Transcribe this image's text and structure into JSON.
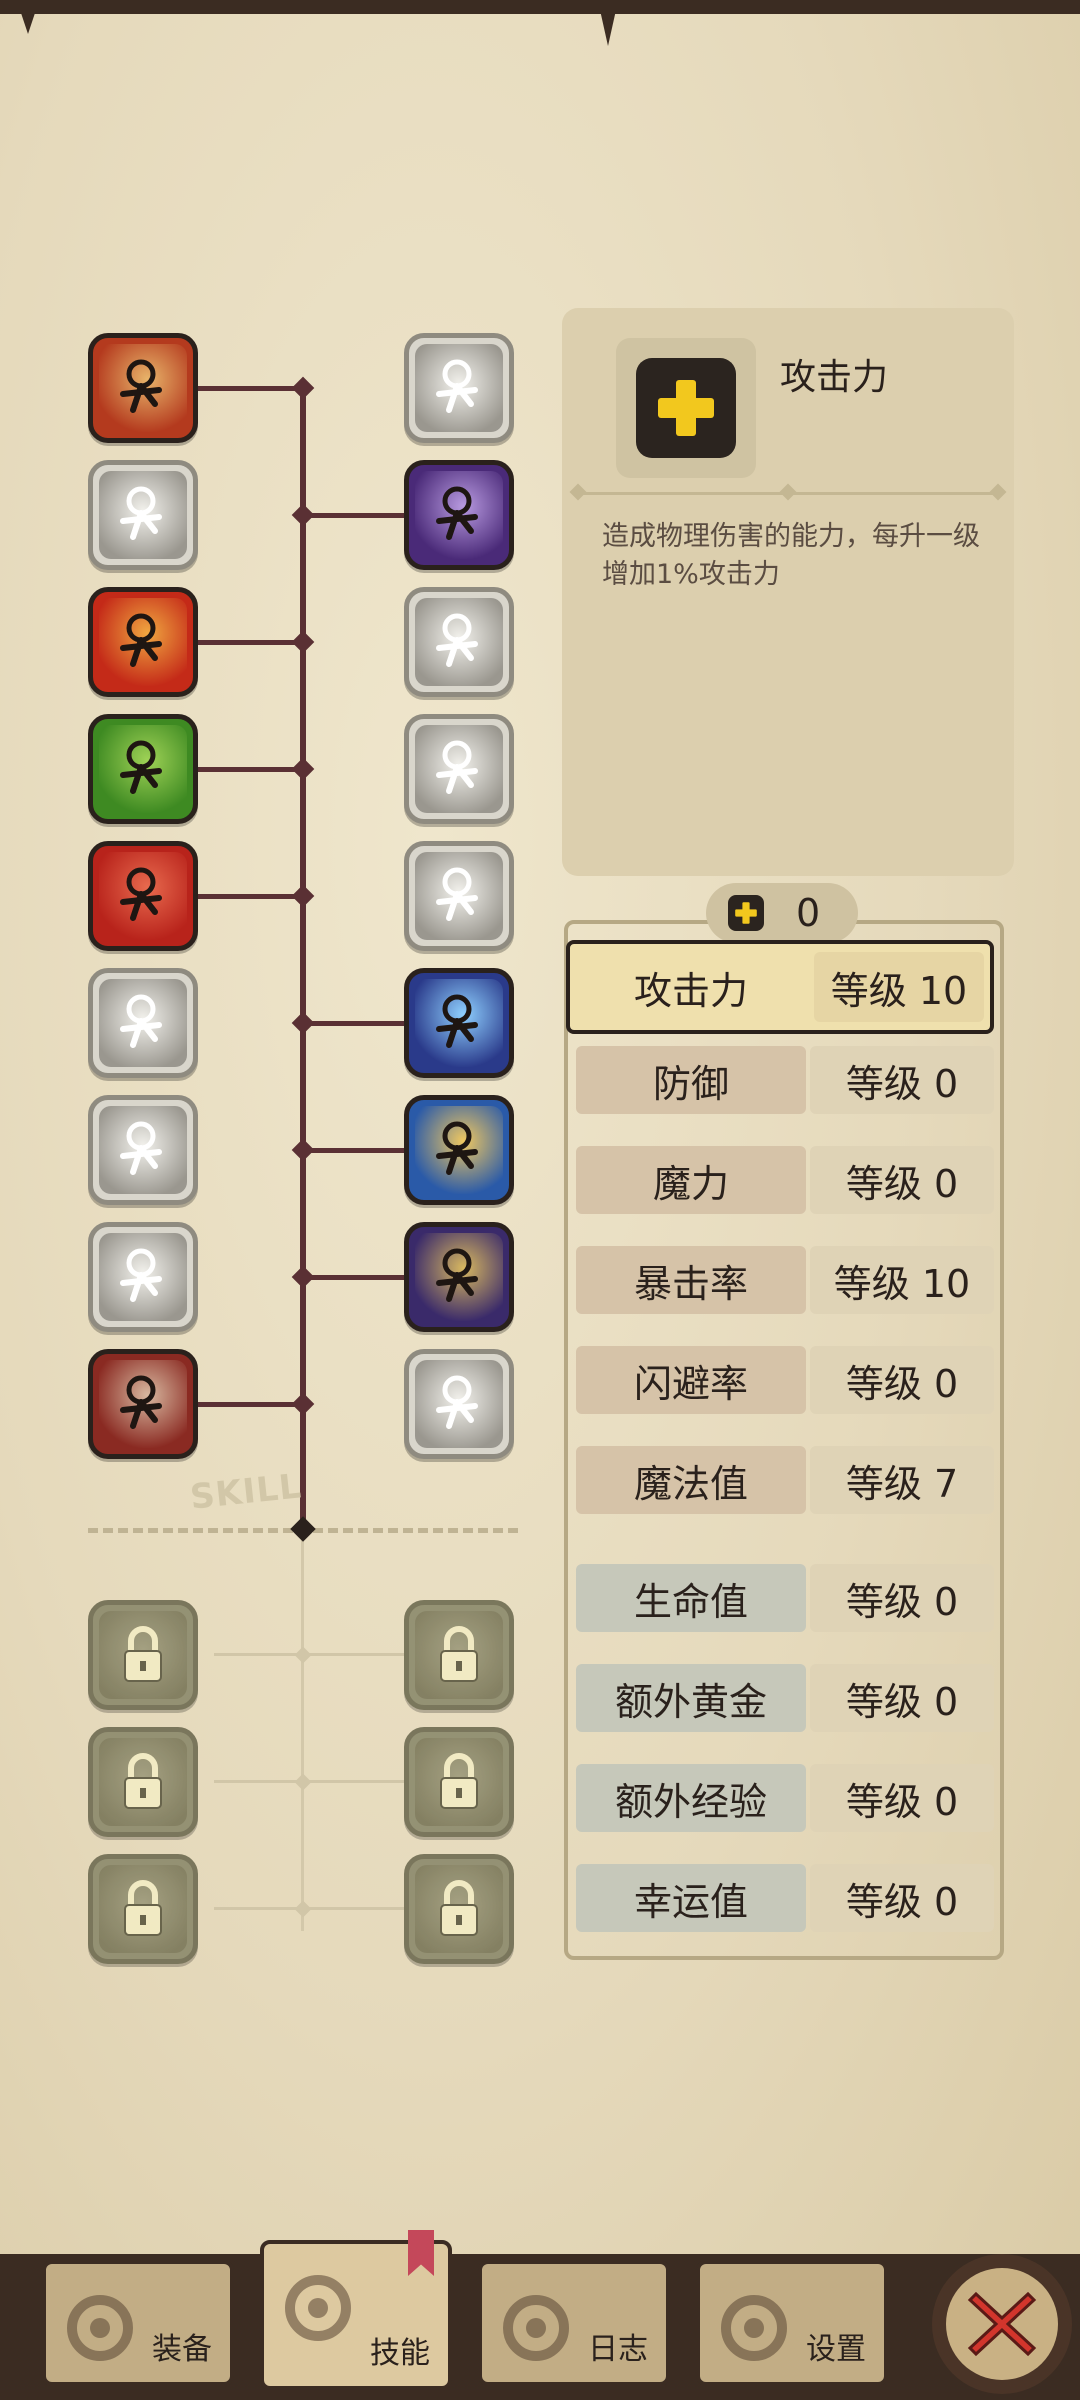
{
  "tree": {
    "watermark": "SKILL",
    "left_nodes": [
      {
        "icon": "blade-strike-icon",
        "active": true,
        "colors": [
          "#b43a1e",
          "#e8b46a"
        ]
      },
      {
        "icon": "dash-kick-icon",
        "active": false
      },
      {
        "icon": "rage-face-icon",
        "active": true,
        "colors": [
          "#c42a18",
          "#f0a640"
        ]
      },
      {
        "icon": "muscle-arm-icon",
        "active": true,
        "colors": [
          "#3e8a22",
          "#9fd256"
        ]
      },
      {
        "icon": "power-punch-icon",
        "active": true,
        "colors": [
          "#b8231b",
          "#e86a4e"
        ]
      },
      {
        "icon": "sword-stance-icon",
        "active": false
      },
      {
        "icon": "shadow-dash-icon",
        "active": false
      },
      {
        "icon": "lightning-figure-icon",
        "active": false
      },
      {
        "icon": "crossed-swords-icon",
        "active": true,
        "colors": [
          "#8a2a22",
          "#d8b8a0"
        ]
      }
    ],
    "right_nodes": [
      {
        "icon": "holy-shield-icon",
        "active": false
      },
      {
        "icon": "shadow-slash-icon",
        "active": true,
        "colors": [
          "#4a2a78",
          "#b89ae0"
        ]
      },
      {
        "icon": "lightning-block-icon",
        "active": false
      },
      {
        "icon": "shoulder-charge-icon",
        "active": false
      },
      {
        "icon": "smoke-stomp-icon",
        "active": false
      },
      {
        "icon": "evil-eye-icon",
        "active": true,
        "colors": [
          "#2a3a8a",
          "#8fd0ff"
        ]
      },
      {
        "icon": "spinning-blade-icon",
        "active": true,
        "colors": [
          "#2a5aa8",
          "#f0c860"
        ]
      },
      {
        "icon": "cosmic-orb-icon",
        "active": true,
        "colors": [
          "#3a2a6a",
          "#d8b860"
        ]
      },
      {
        "icon": "sparkle-figure-icon",
        "active": false
      }
    ],
    "locked_left": [
      {
        "icon": "lock-icon"
      },
      {
        "icon": "lock-icon"
      },
      {
        "icon": "lock-icon"
      }
    ],
    "locked_right": [
      {
        "icon": "lock-icon"
      },
      {
        "icon": "lock-icon"
      },
      {
        "icon": "lock-icon"
      }
    ]
  },
  "card": {
    "icon": "plus-icon",
    "title": "攻击力",
    "description": "造成物理伤害的能力，每升一级增加1%攻击力"
  },
  "points": {
    "icon": "plus-icon",
    "value": "0"
  },
  "stats": [
    {
      "name": "攻击力",
      "level": "等级 10",
      "group": "red",
      "selected": true
    },
    {
      "name": "防御",
      "level": "等级 0",
      "group": "red",
      "selected": false
    },
    {
      "name": "魔力",
      "level": "等级 0",
      "group": "red",
      "selected": false
    },
    {
      "name": "暴击率",
      "level": "等级 10",
      "group": "red",
      "selected": false
    },
    {
      "name": "闪避率",
      "level": "等级 0",
      "group": "red",
      "selected": false
    },
    {
      "name": "魔法值",
      "level": "等级 7",
      "group": "red",
      "selected": false
    },
    {
      "name": "生命值",
      "level": "等级 0",
      "group": "blue",
      "selected": false
    },
    {
      "name": "额外黄金",
      "level": "等级 0",
      "group": "blue",
      "selected": false
    },
    {
      "name": "额外经验",
      "level": "等级 0",
      "group": "blue",
      "selected": false
    },
    {
      "name": "幸运值",
      "level": "等级 0",
      "group": "blue",
      "selected": false
    }
  ],
  "nav": {
    "tabs": [
      {
        "label": "装备",
        "icon": "axe-icon",
        "active": false
      },
      {
        "label": "技能",
        "icon": "skill-ring-icon",
        "active": true
      },
      {
        "label": "日志",
        "icon": "journal-icon",
        "active": false
      },
      {
        "label": "设置",
        "icon": "gear-icon",
        "active": false
      }
    ],
    "close_icon": "close-icon"
  }
}
